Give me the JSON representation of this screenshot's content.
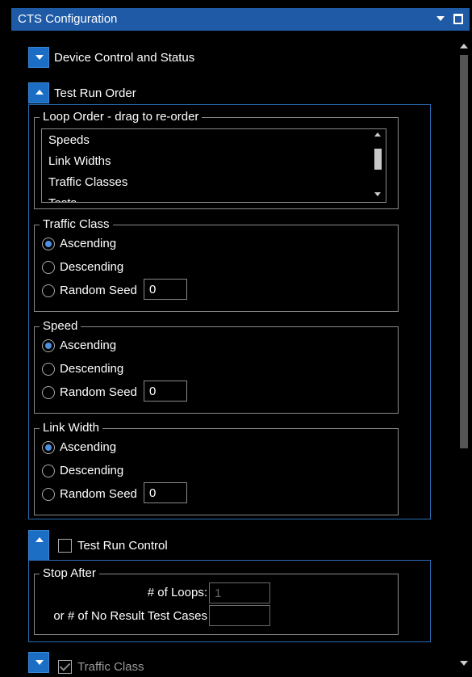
{
  "window": {
    "title": "CTS Configuration",
    "menu_icon": "chevron-down-icon",
    "maximize_icon": "maximize-icon"
  },
  "sections": {
    "device_control": {
      "label": "Device Control and Status"
    },
    "test_run_order": {
      "label": "Test Run Order",
      "loop_order": {
        "label": "Loop Order - drag to re-order",
        "items": [
          "Speeds",
          "Link Widths",
          "Traffic Classes",
          "Tests"
        ]
      },
      "traffic_class": {
        "label": "Traffic Class",
        "options": [
          "Ascending",
          "Descending",
          "Random Seed"
        ],
        "selected": "Ascending",
        "seed_value": "0"
      },
      "speed": {
        "label": "Speed",
        "options": [
          "Ascending",
          "Descending",
          "Random Seed"
        ],
        "selected": "Ascending",
        "seed_value": "0"
      },
      "link_width": {
        "label": "Link Width",
        "options": [
          "Ascending",
          "Descending",
          "Random Seed"
        ],
        "selected": "Ascending",
        "seed_value": "0"
      }
    },
    "test_run_control": {
      "label": "Test Run Control",
      "checked": false,
      "stop_after": {
        "label": "Stop After",
        "loops_label": "# of Loops:",
        "loops_value": "1",
        "no_result_label": "or # of No Result Test Cases",
        "no_result_value": ""
      }
    },
    "traffic_class_section": {
      "label": "Traffic Class",
      "checked": true
    }
  }
}
